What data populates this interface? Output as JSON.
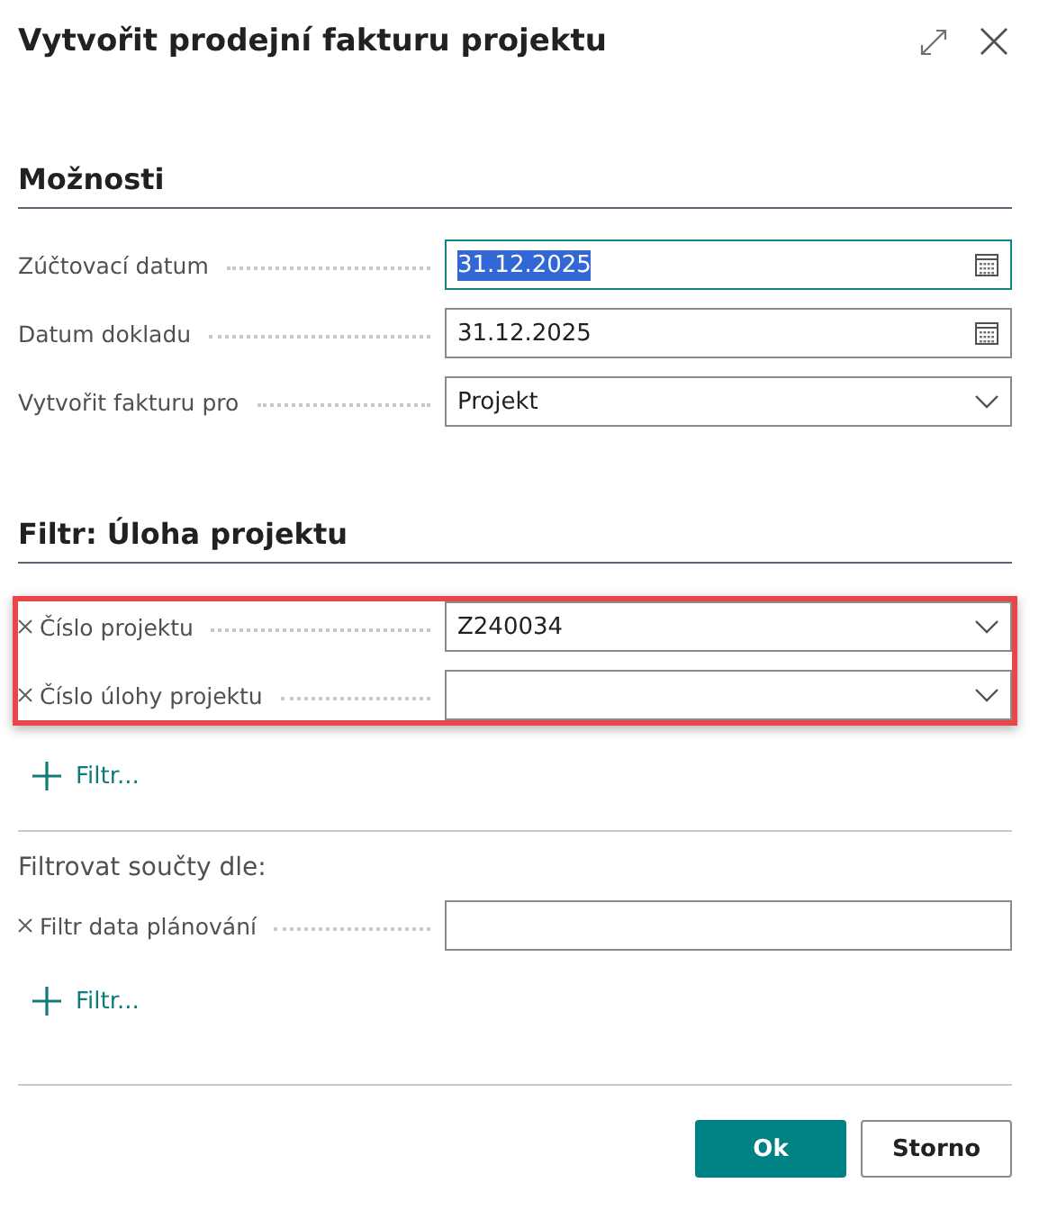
{
  "dialog": {
    "title": "Vytvořit prodejní fakturu projektu"
  },
  "options": {
    "heading": "Možnosti",
    "fields": [
      {
        "label": "Zúčtovací datum",
        "kind": "date",
        "value": "31.12.2025",
        "focused": true,
        "text_selected": true
      },
      {
        "label": "Datum dokladu",
        "kind": "date",
        "value": "31.12.2025",
        "focused": false,
        "text_selected": false
      },
      {
        "label": "Vytvořit fakturu pro",
        "kind": "select",
        "value": "Projekt",
        "focused": false,
        "text_selected": false
      }
    ]
  },
  "task_filter": {
    "heading": "Filtr: Úloha projektu",
    "highlighted": true,
    "fields": [
      {
        "label": "Číslo projektu",
        "kind": "select",
        "value": "Z240034",
        "removable": true
      },
      {
        "label": "Číslo úlohy projektu",
        "kind": "select",
        "removable": true
      }
    ],
    "add_filter": "Filtr..."
  },
  "totals_filter": {
    "heading": "Filtrovat součty dle:",
    "fields": [
      {
        "label": "Filtr data plánování",
        "kind": "text",
        "removable": true
      }
    ],
    "add_filter": "Filtr..."
  },
  "buttons": [
    {
      "label": "Ok",
      "primary": true
    },
    {
      "label": "Storno",
      "primary": false
    }
  ]
}
